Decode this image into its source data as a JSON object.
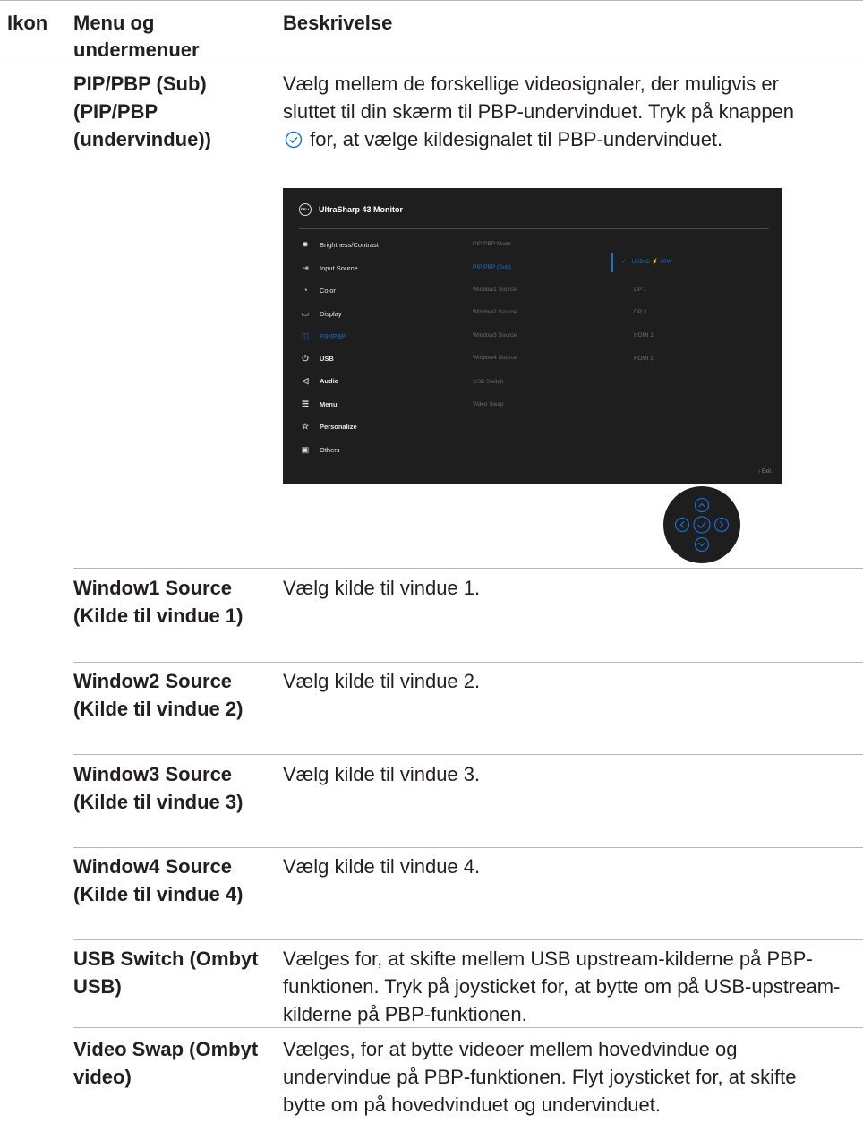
{
  "header": {
    "col_icon": "Ikon",
    "col_menu": "Menu og undermenuer",
    "col_desc": "Beskrivelse"
  },
  "rows": [
    {
      "menu": "PIP/PBP (Sub) (PIP/PBP (undervindue))",
      "desc_before": "Vælg mellem de forskellige videosignaler, der muligvis er sluttet til din skærm til PBP-undervinduet. Tryk på knappen",
      "desc_after": "for, at vælge kildesignalet til PBP-undervinduet."
    },
    {
      "menu": "Window1 Source (Kilde til vindue 1)",
      "desc": "Vælg kilde til vindue 1."
    },
    {
      "menu": "Window2 Source (Kilde til vindue 2)",
      "desc": "Vælg kilde til vindue 2."
    },
    {
      "menu": "Window3 Source (Kilde til vindue 3)",
      "desc": "Vælg kilde til vindue 3."
    },
    {
      "menu": "Window4 Source (Kilde til vindue 4)",
      "desc": "Vælg kilde til vindue 4."
    },
    {
      "menu": "USB Switch (Ombyt USB)",
      "desc": "Vælges for, at skifte mellem USB upstream-kilderne på PBP-funktionen. Tryk på joysticket for, at bytte om på USB-upstream-kilderne på PBP-funktionen."
    },
    {
      "menu": "Video Swap (Ombyt video)",
      "desc": "Vælges, for at bytte videoer mellem hovedvindue og undervindue på PBP-funktionen. Flyt joysticket for, at skifte bytte om på hovedvinduet og undervinduet."
    }
  ],
  "osd": {
    "logo": "DELL",
    "title": "UltraSharp 43 Monitor",
    "menu_items": [
      {
        "label": "Brightness/Contrast",
        "icon": "sun-icon"
      },
      {
        "label": "Input Source",
        "icon": "input-icon"
      },
      {
        "label": "Color",
        "icon": "palette-icon"
      },
      {
        "label": "Display",
        "icon": "monitor-icon"
      },
      {
        "label": "PIP/PBP",
        "icon": "pip-icon"
      },
      {
        "label": "USB",
        "icon": "usb-icon"
      },
      {
        "label": "Audio",
        "icon": "speaker-icon"
      },
      {
        "label": "Menu",
        "icon": "menu-icon"
      },
      {
        "label": "Personalize",
        "icon": "star-icon"
      },
      {
        "label": "Others",
        "icon": "others-icon"
      }
    ],
    "sub_items": [
      "PIP/PBP Mode",
      "PIP/PBP (Sub)",
      "Window1 Source",
      "Window2 Source",
      "Window3 Source",
      "Window4 Source",
      "USB Switch",
      "Video Swap"
    ],
    "options": [
      "USB-C ⚡ 90W",
      "DP 1",
      "DP 2",
      "HDMI 1",
      "HDMI 2"
    ],
    "selected_check": "✓",
    "exit": "‹  Exit",
    "accent": "#1a6fd1"
  }
}
